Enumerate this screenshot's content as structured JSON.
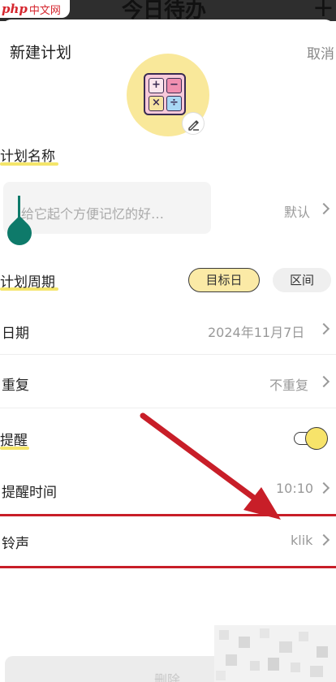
{
  "watermark": {
    "logo": "php",
    "text": "中文网"
  },
  "background": {
    "title": "今日待办",
    "add_icon": "+"
  },
  "header": {
    "title": "新建计划",
    "cancel": "取消"
  },
  "avatar": {
    "icon": "calculator-icon",
    "keys": [
      "+",
      "−",
      "×",
      "÷"
    ],
    "edit_icon": "pencil-icon"
  },
  "plan_name": {
    "label": "计划名称",
    "placeholder": "给它起个方便记忆的好…",
    "value": "默认"
  },
  "plan_period": {
    "label": "计划周期",
    "options": [
      "目标日",
      "区间"
    ],
    "selected": "目标日"
  },
  "rows": {
    "date": {
      "label": "日期",
      "value": "2024年11月7日"
    },
    "repeat": {
      "label": "重复",
      "value": "不重复"
    },
    "reminder": {
      "label": "提醒",
      "enabled": true
    },
    "reminder_time": {
      "label": "提醒时间",
      "value": "10:10"
    },
    "ringtone": {
      "label": "铃声",
      "value": "klik"
    }
  },
  "bottom_button": {
    "label": "删除"
  },
  "colors": {
    "highlight": "#f4e56a",
    "accent_pill": "#fbeaa6",
    "annotation_red": "#c81e28",
    "cursor": "#0e7a6a",
    "avatar_bg": "#f9e89a"
  }
}
